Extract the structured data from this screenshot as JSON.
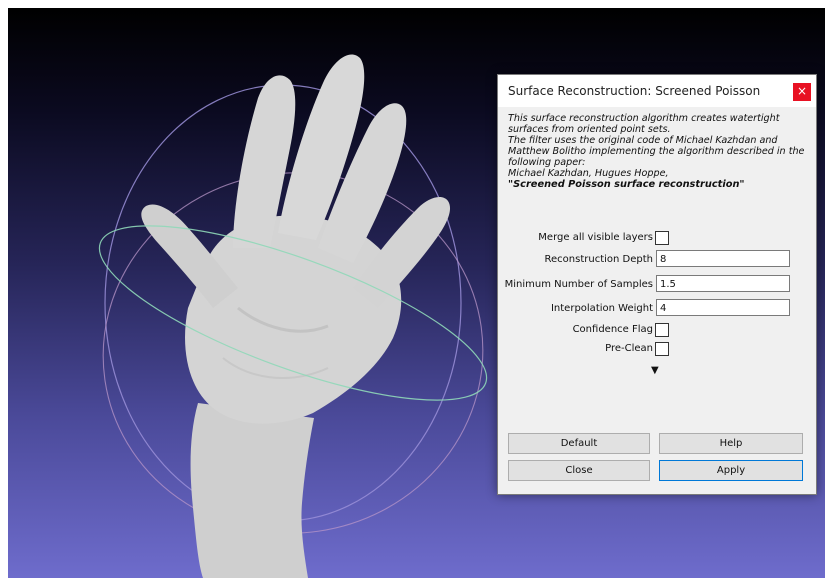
{
  "dialog": {
    "title": "Surface Reconstruction: Screened Poisson",
    "close_glyph": "×",
    "description": [
      "This surface reconstruction algorithm creates watertight",
      "surfaces from oriented point sets.",
      "The filter uses the original code of Michael Kazhdan and",
      "Matthew Bolitho implementing the algorithm described in the",
      "following paper:",
      "Michael Kazhdan, Hugues Hoppe,"
    ],
    "paper_title": "\"Screened Poisson surface reconstruction\"",
    "params": {
      "merge_layers": {
        "label": "Merge all visible layers",
        "checked": false
      },
      "reconstruction_depth": {
        "label": "Reconstruction Depth",
        "value": "8"
      },
      "min_samples": {
        "label": "Minimum Number of Samples",
        "value": "1.5"
      },
      "interpolation_weight": {
        "label": "Interpolation Weight",
        "value": "4"
      },
      "confidence_flag": {
        "label": "Confidence Flag",
        "checked": false
      },
      "pre_clean": {
        "label": "Pre-Clean",
        "checked": false
      }
    },
    "expand_arrow": "▼",
    "buttons": {
      "default": "Default",
      "help": "Help",
      "close": "Close",
      "apply": "Apply"
    }
  },
  "viewport": {
    "background_top": "#000000",
    "background_bottom": "#6e6ccc",
    "mesh_color": "#d2d2d2",
    "trackball_colors": [
      "#9a8fd8",
      "#c89ab8",
      "#8fd8b8"
    ]
  }
}
